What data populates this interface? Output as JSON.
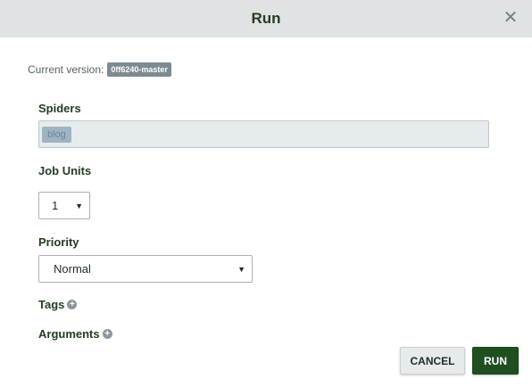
{
  "dialog": {
    "title": "Run",
    "close_icon": "close-icon"
  },
  "version": {
    "label": "Current version:",
    "value": "0ff6240-master"
  },
  "spiders": {
    "label": "Spiders",
    "selected": [
      "blog"
    ]
  },
  "job_units": {
    "label": "Job Units",
    "value": "1"
  },
  "priority": {
    "label": "Priority",
    "value": "Normal"
  },
  "tags": {
    "label": "Tags"
  },
  "arguments": {
    "label": "Arguments"
  },
  "buttons": {
    "cancel": "CANCEL",
    "run": "RUN"
  },
  "colors": {
    "header_bg": "#dfe3e4",
    "title_color": "#243d22",
    "run_button_bg": "#1f4f1f",
    "version_badge_bg": "#7d8b91"
  }
}
